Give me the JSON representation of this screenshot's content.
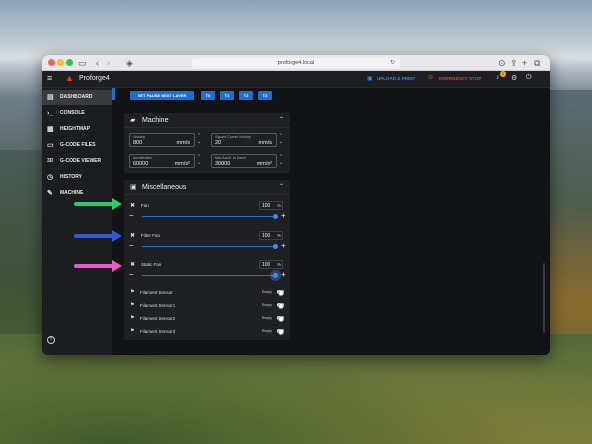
{
  "browser": {
    "url": "proforge4.local"
  },
  "app": {
    "title": "Proforge4",
    "upload_label": "UPLOAD & PRINT",
    "estop_label": "EMERGENCY STOP",
    "notif_count": "1"
  },
  "sidebar": {
    "items": [
      {
        "label": "DASHBOARD",
        "icon": "dashboard-icon",
        "glyph": "▤"
      },
      {
        "label": "CONSOLE",
        "icon": "console-icon",
        "glyph": "›_"
      },
      {
        "label": "HEIGHTMAP",
        "icon": "heightmap-icon",
        "glyph": "▦"
      },
      {
        "label": "G-CODE FILES",
        "icon": "files-icon",
        "glyph": "▭"
      },
      {
        "label": "G-CODE VIEWER",
        "icon": "viewer-icon",
        "glyph": "3D"
      },
      {
        "label": "HISTORY",
        "icon": "history-icon",
        "glyph": "◷"
      },
      {
        "label": "MACHINE",
        "icon": "wrench-icon",
        "glyph": "✎"
      }
    ],
    "help_icon": "help-icon"
  },
  "toolbar": {
    "pause_label": "SET PAUSE NEXT LAYER",
    "tools": [
      "T0",
      "T1",
      "T2",
      "T3"
    ]
  },
  "machine": {
    "title": "Machine",
    "fields": [
      {
        "label": "Velocity",
        "value": "800",
        "unit": "mm/s"
      },
      {
        "label": "Square Corner Velocity",
        "value": "20",
        "unit": "mm/s"
      },
      {
        "label": "Acceleration",
        "value": "60000",
        "unit": "mm/s²"
      },
      {
        "label": "Max Accel. to Decel",
        "value": "30000",
        "unit": "mm/s²"
      }
    ]
  },
  "misc": {
    "title": "Miscellaneous",
    "fans": [
      {
        "name": "Fan",
        "value": "100",
        "unit": "%",
        "level": 1.0
      },
      {
        "name": "Filter Fan",
        "value": "100",
        "unit": "%",
        "level": 1.0
      },
      {
        "name": "Static Fan",
        "value": "100",
        "unit": "%",
        "level": 1.0
      }
    ],
    "sensors": [
      {
        "name": "Filament Sensor",
        "status": "Empty",
        "enabled": true
      },
      {
        "name": "Filament Sensor1",
        "status": "Empty",
        "enabled": true
      },
      {
        "name": "Filament Sensor2",
        "status": "Empty",
        "enabled": true
      },
      {
        "name": "Filament Sensor3",
        "status": "Empty",
        "enabled": true
      }
    ]
  },
  "colors": {
    "accent": "#1f6fd1",
    "estop": "#e53935",
    "upload": "#3b82f6",
    "arrow_green": "#2ecc71",
    "arrow_blue": "#2f5bd8",
    "arrow_pink": "#e85cc0"
  }
}
